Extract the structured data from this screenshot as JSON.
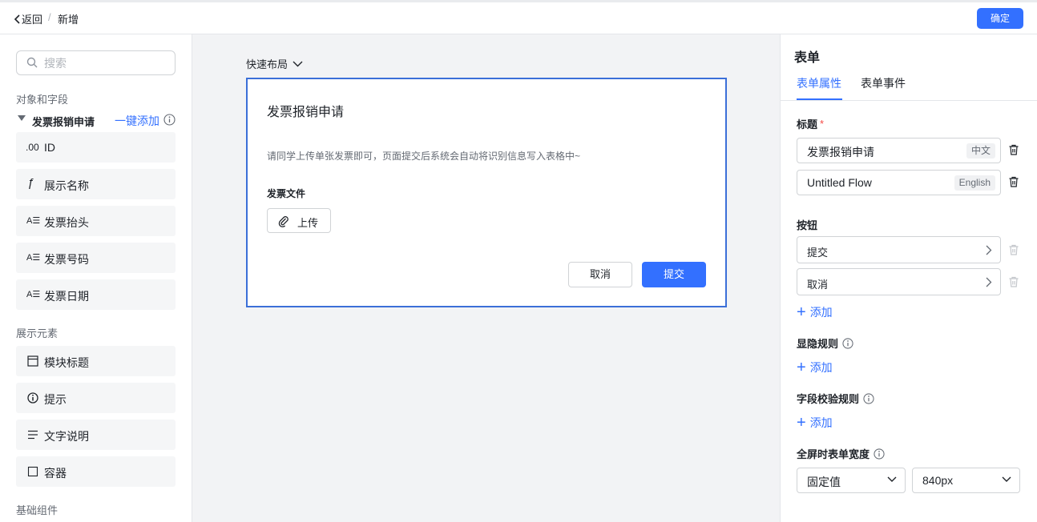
{
  "header": {
    "back_label": "返回",
    "separator": "/",
    "current": "新增",
    "confirm_label": "确定"
  },
  "sidebar": {
    "search_placeholder": "搜索",
    "objects_title": "对象和字段",
    "group_name": "发票报销申请",
    "one_click_add": "一键添加",
    "fields": [
      {
        "icon": ".00",
        "label": "ID"
      },
      {
        "icon": "ƒ",
        "label": "展示名称"
      },
      {
        "icon": "A☰",
        "label": "发票抬头"
      },
      {
        "icon": "A☰",
        "label": "发票号码"
      },
      {
        "icon": "A☰",
        "label": "发票日期"
      }
    ],
    "display_title": "展示元素",
    "display_items": [
      {
        "icon": "module-title-icon",
        "label": "模块标题"
      },
      {
        "icon": "info-icon",
        "label": "提示"
      },
      {
        "icon": "text-lines-icon",
        "label": "文字说明"
      },
      {
        "icon": "container-icon",
        "label": "容器"
      }
    ],
    "basic_title": "基础组件"
  },
  "canvas": {
    "quick_layout": "快速布局",
    "form": {
      "title": "发票报销申请",
      "description": "请同学上传单张发票即可，页面提交后系统会自动将识别信息写入表格中~",
      "field_label": "发票文件",
      "upload_label": "上传",
      "cancel_label": "取消",
      "submit_label": "提交"
    }
  },
  "panel": {
    "title": "表单",
    "tabs": [
      "表单属性",
      "表单事件"
    ],
    "title_section": "标题",
    "required_mark": "*",
    "title_zh": {
      "value": "发票报销申请",
      "lang": "中文"
    },
    "title_en": {
      "value": "Untitled Flow",
      "lang": "English"
    },
    "buttons_section": "按钮",
    "buttons": [
      "提交",
      "取消"
    ],
    "add_label": "添加",
    "visibility_section": "显隐规则",
    "validation_section": "字段校验规则",
    "width_section": "全屏时表单宽度",
    "width_mode": "固定值",
    "width_value": "840px"
  },
  "colors": {
    "accent": "#3370ff",
    "selected_border": "#3b6fd8",
    "canvas_bg": "#f2f3f5",
    "required": "#f54a45"
  }
}
